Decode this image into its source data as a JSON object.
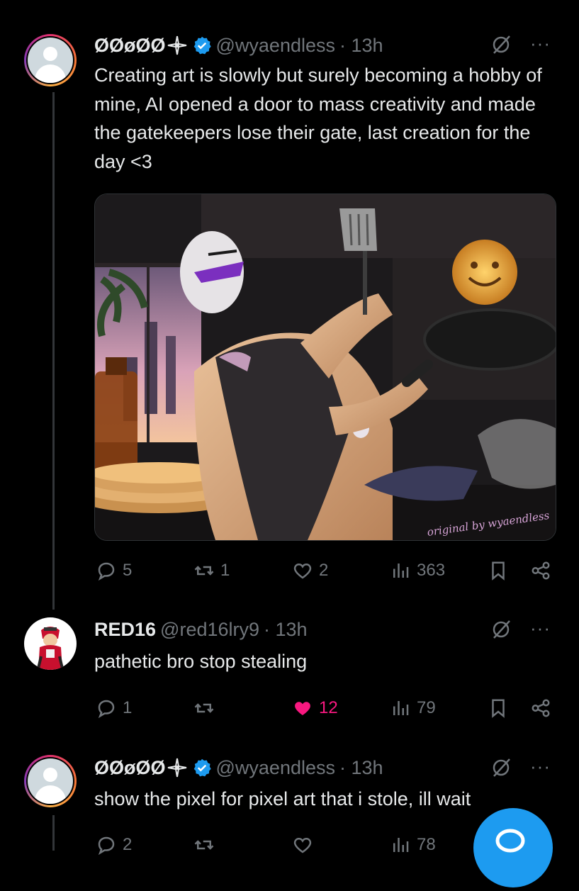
{
  "thread_line_color": "#333639",
  "posts": [
    {
      "display_name": "ØØøØØ",
      "name_emoji": "4-pointed-star-emoji",
      "verified": true,
      "handle": "@wyaendless",
      "time": "· 13h",
      "text": "Creating art is slowly but surely becoming a hobby of mine, AI opened a door to mass creativity and made the gatekeepers lose their gate, last creation for the day <3",
      "media_watermark": "original by wyaendless",
      "replies": "5",
      "reposts": "1",
      "likes": "2",
      "views": "363"
    },
    {
      "display_name": "RED16",
      "verified": false,
      "handle": "@red16lry9",
      "time": "· 13h",
      "text": "pathetic bro stop stealing",
      "replies": "1",
      "reposts": "",
      "likes": "12",
      "liked": true,
      "views": "79"
    },
    {
      "display_name": "ØØøØØ",
      "name_emoji": "4-pointed-star-emoji",
      "verified": true,
      "handle": "@wyaendless",
      "time": "· 13h",
      "text": "show the pixel for pixel art that i stole, ill wait",
      "replies": "2",
      "reposts": "",
      "likes": "",
      "views": "78"
    }
  ],
  "colors": {
    "background": "#000000",
    "text": "#e7e9ea",
    "muted": "#71767b",
    "verified": "#1d9bf0",
    "like": "#f91880",
    "fab": "#1d9bf0"
  }
}
